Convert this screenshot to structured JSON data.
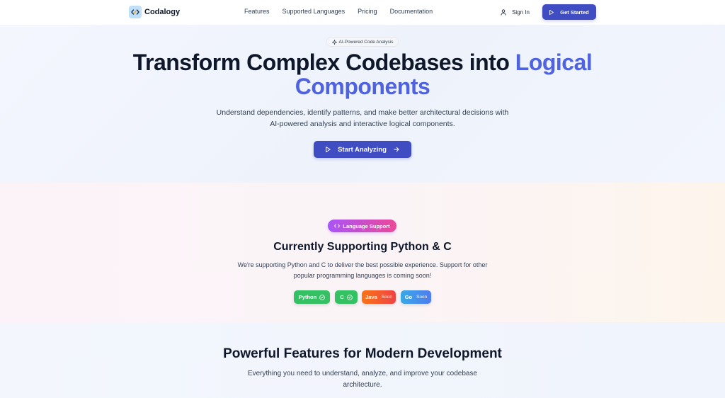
{
  "nav": {
    "brand": "Codalogy",
    "links": [
      "Features",
      "Supported Languages",
      "Pricing",
      "Documentation"
    ],
    "sign_in": "Sign In",
    "get_started": "Get Started"
  },
  "hero": {
    "badge": "AI-Powered Code Analysis",
    "title_part1": "Transform Complex Codebases into",
    "title_accent_1": "Logical",
    "title_accent_2": "Components",
    "subtitle": "Understand dependencies, identify patterns, and make better architectural decisions with AI-powered analysis and interactive logical components.",
    "cta": "Start Analyzing"
  },
  "languages": {
    "badge": "Language Support",
    "title": "Currently Supporting Python & C",
    "subtitle": "We're supporting Python and C to deliver the best possible experience. Support for other popular programming languages is coming soon!",
    "pills": [
      {
        "name": "Python",
        "status": "supported"
      },
      {
        "name": "C",
        "status": "supported"
      },
      {
        "name": "Java",
        "status": "Soon"
      },
      {
        "name": "Go",
        "status": "Soon"
      }
    ]
  },
  "features": {
    "title": "Powerful Features for Modern Development",
    "subtitle": "Everything you need to understand, analyze, and improve your codebase architecture."
  },
  "colors": {
    "primary": "#3f4cc2",
    "accent_text": "#4f62e0",
    "supported_green": "#34c163"
  }
}
